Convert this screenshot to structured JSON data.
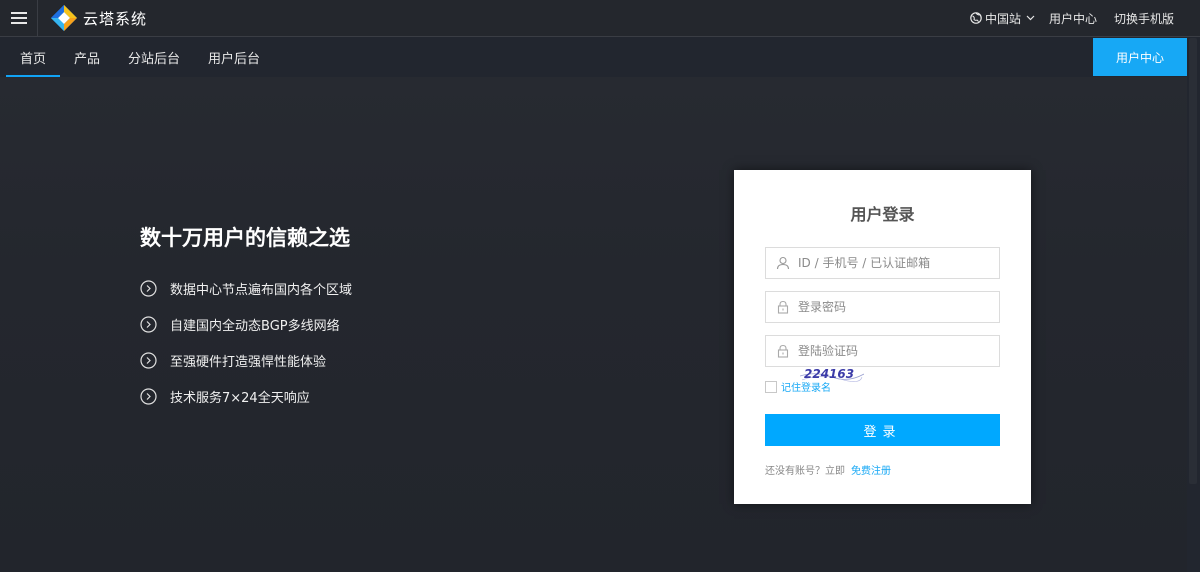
{
  "header": {
    "logo_text": "云塔系统",
    "region_label": "中国站",
    "user_center_link": "用户中心",
    "mobile_link": "切换手机版"
  },
  "nav": {
    "tabs": [
      {
        "label": "首页",
        "active": true
      },
      {
        "label": "产品",
        "active": false
      },
      {
        "label": "分站后台",
        "active": false
      },
      {
        "label": "用户后台",
        "active": false
      }
    ],
    "user_center_button": "用户中心"
  },
  "hero": {
    "title": "数十万用户的信赖之选",
    "features": [
      "数据中心节点遍布国内各个区域",
      "自建国内全动态BGP多线网络",
      "至强硬件打造强悍性能体验",
      "技术服务7×24全天响应"
    ]
  },
  "login": {
    "title": "用户登录",
    "username_placeholder": "ID / 手机号 / 已认证邮箱",
    "password_placeholder": "登录密码",
    "captcha_placeholder": "登陆验证码",
    "captcha_text": "224163",
    "remember_label": "记住登录名",
    "submit_label": "登录",
    "register_prompt": "还没有账号？立即",
    "register_link": "免费注册"
  },
  "colors": {
    "accent": "#00a8ff",
    "background": "#22262f",
    "topbar": "#24272d"
  },
  "icons": {
    "menu": "hamburger-icon",
    "logo": "cloud-tower-logo",
    "globe": "globe-icon",
    "chevron": "chevron-down-icon",
    "feature": "circle-chevron-right-icon",
    "user": "user-icon",
    "lock": "lock-icon"
  }
}
